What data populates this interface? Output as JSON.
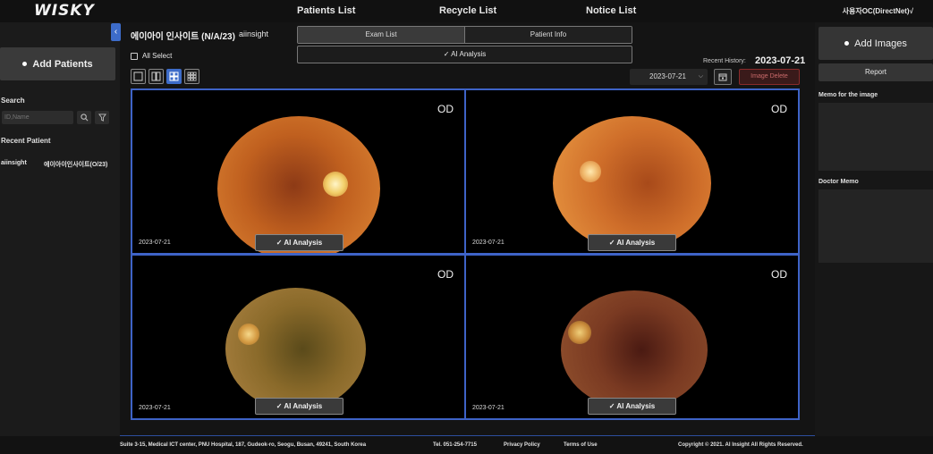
{
  "app": {
    "logo": "WISKY",
    "nav": [
      "Patients List",
      "Recycle List",
      "Notice List"
    ],
    "user": "사용자OC(DirectNet)√"
  },
  "left_sidebar": {
    "add_patients_label": "Add Patients",
    "search_label": "Search",
    "search_placeholder": "ID,Name",
    "recent_label": "Recent Patient",
    "recent_patient": {
      "id": "aiinsight",
      "name": "에이아이인사이트(O/23)"
    }
  },
  "patient_header": {
    "title": "에이아이 인사이트 (N/A/23)",
    "id": "aiinsight",
    "tabs": [
      "Exam List",
      "Patient Info"
    ],
    "ai_analysis_bar": "✓  AI Analysis",
    "all_select": "All Select",
    "recent_history_label": "Recent History:",
    "recent_history_date": "2023-07-21",
    "date_select_value": "2023-07-21",
    "image_delete_label": "Image Delete"
  },
  "images": [
    {
      "eye": "OD",
      "date": "2023-07-21",
      "ai_label": "✓  AI Analysis"
    },
    {
      "eye": "OD",
      "date": "2023-07-21",
      "ai_label": "✓  AI Analysis"
    },
    {
      "eye": "OD",
      "date": "2023-07-21",
      "ai_label": "✓  AI Analysis"
    },
    {
      "eye": "OD",
      "date": "2023-07-21",
      "ai_label": "✓  AI Analysis"
    }
  ],
  "right_sidebar": {
    "add_images_label": "Add Images",
    "report_label": "Report",
    "memo_image_label": "Memo for the image",
    "doctor_memo_label": "Doctor Memo"
  },
  "footer": {
    "address": "Suite 3-15, Medical ICT center, PNU Hospital, 187, Gudeok-ro, Seogu, Busan, 49241, South Korea",
    "tel": "Tel. 051-254-7715",
    "privacy": "Privacy Policy",
    "terms": "Terms of Use",
    "copyright": "Copyright © 2021. AI Insight All Rights Reserved."
  },
  "colors": {
    "accent": "#3e63c7",
    "background": "#141414",
    "panel": "#353535"
  }
}
